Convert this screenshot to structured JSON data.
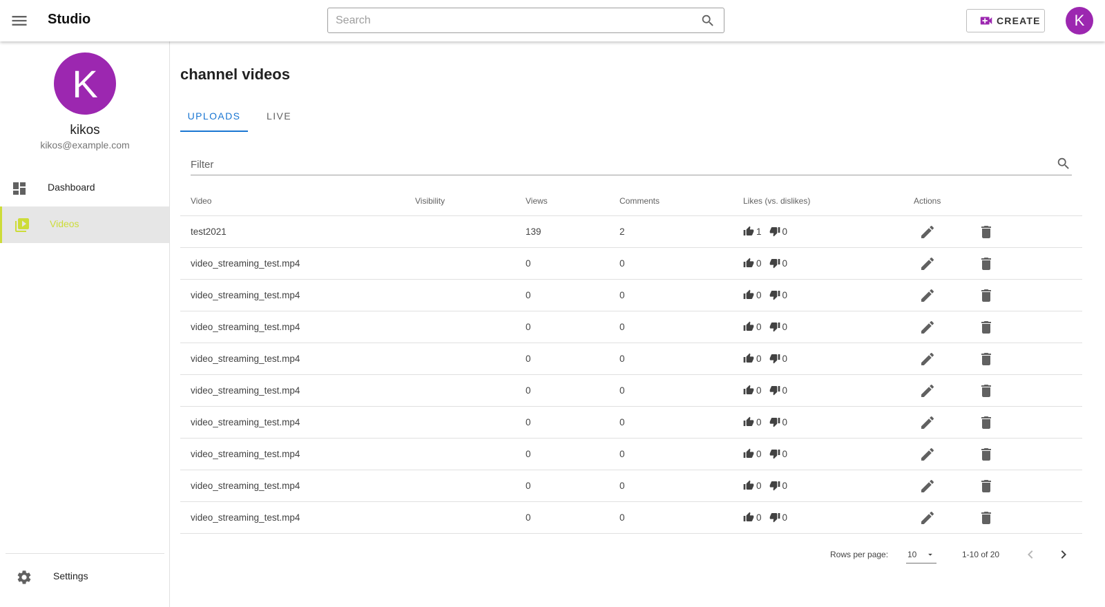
{
  "appbar": {
    "brand": "Studio",
    "search_placeholder": "Search",
    "create_label": "CREATE",
    "avatar_letter": "K"
  },
  "sidebar": {
    "avatar_letter": "K",
    "user_name": "kikos",
    "user_email": "kikos@example.com",
    "items": [
      {
        "label": "Dashboard",
        "icon": "dashboard-icon"
      },
      {
        "label": "Videos",
        "icon": "video-library-icon",
        "active": true
      }
    ],
    "settings_label": "Settings"
  },
  "main": {
    "title": "channel videos",
    "tabs": [
      {
        "label": "UPLOADS",
        "active": true
      },
      {
        "label": "LIVE"
      }
    ],
    "filter_placeholder": "Filter",
    "columns": {
      "video": "Video",
      "visibility": "Visibility",
      "views": "Views",
      "comments": "Comments",
      "likes": "Likes (vs. dislikes)",
      "actions": "Actions"
    },
    "rows": [
      {
        "video": "test2021",
        "visibility": "",
        "views": "139",
        "comments": "2",
        "likes": "1",
        "dislikes": "0"
      },
      {
        "video": "video_streaming_test.mp4",
        "visibility": "",
        "views": "0",
        "comments": "0",
        "likes": "0",
        "dislikes": "0"
      },
      {
        "video": "video_streaming_test.mp4",
        "visibility": "",
        "views": "0",
        "comments": "0",
        "likes": "0",
        "dislikes": "0"
      },
      {
        "video": "video_streaming_test.mp4",
        "visibility": "",
        "views": "0",
        "comments": "0",
        "likes": "0",
        "dislikes": "0"
      },
      {
        "video": "video_streaming_test.mp4",
        "visibility": "",
        "views": "0",
        "comments": "0",
        "likes": "0",
        "dislikes": "0"
      },
      {
        "video": "video_streaming_test.mp4",
        "visibility": "",
        "views": "0",
        "comments": "0",
        "likes": "0",
        "dislikes": "0"
      },
      {
        "video": "video_streaming_test.mp4",
        "visibility": "",
        "views": "0",
        "comments": "0",
        "likes": "0",
        "dislikes": "0"
      },
      {
        "video": "video_streaming_test.mp4",
        "visibility": "",
        "views": "0",
        "comments": "0",
        "likes": "0",
        "dislikes": "0"
      },
      {
        "video": "video_streaming_test.mp4",
        "visibility": "",
        "views": "0",
        "comments": "0",
        "likes": "0",
        "dislikes": "0"
      },
      {
        "video": "video_streaming_test.mp4",
        "visibility": "",
        "views": "0",
        "comments": "0",
        "likes": "0",
        "dislikes": "0"
      }
    ],
    "pagination": {
      "rows_per_page_label": "Rows per page:",
      "rows_per_page": "10",
      "range": "1-10 of 20"
    }
  },
  "colors": {
    "avatar": "#9c27b0",
    "accent": "#1976d2",
    "active_nav": "#cddc39",
    "icon_gray": "#616161"
  }
}
